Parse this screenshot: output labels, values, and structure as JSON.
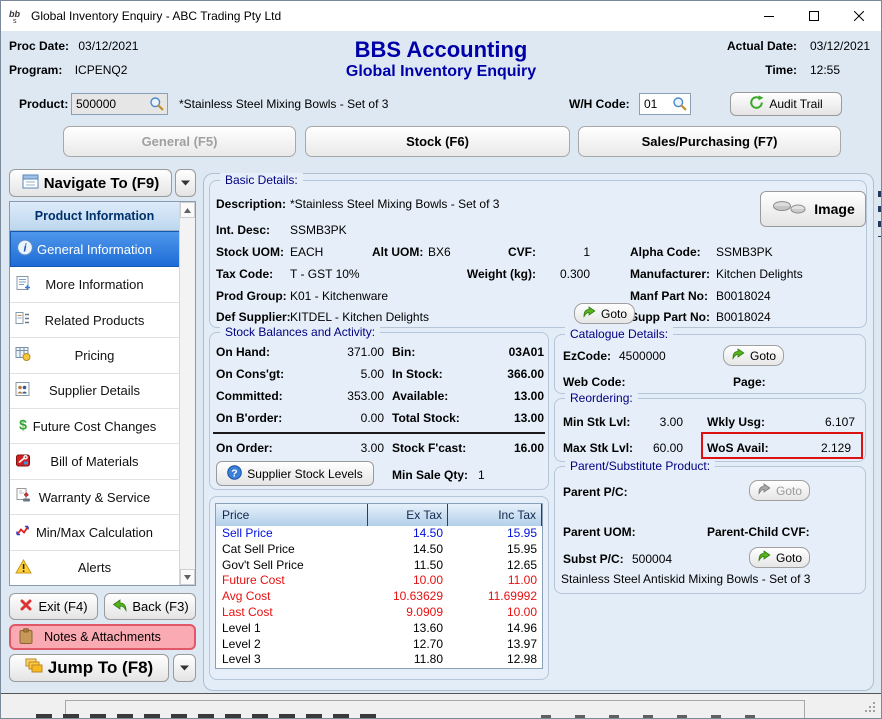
{
  "window": {
    "title": "Global Inventory Enquiry - ABC Trading Pty Ltd"
  },
  "colors": {
    "window_bg": "#dde8f3",
    "titlebar_bg": "#ffffff",
    "navy_title": "#0000a8",
    "selected_item_blue": "#1d6cd6",
    "notes_pink_bg": "#f9aab2",
    "notes_pink_border": "#e05868",
    "goto_green": "#55b41e",
    "price_blue": "#0010dd",
    "price_red": "#e81010",
    "highlight_red": "#dd1111"
  },
  "icons": {
    "app_logo": "bbs-logo",
    "search": "magnifier",
    "goto": "green-curved-arrow",
    "back": "green-undo-arrow",
    "exit": "red-x",
    "audit": "green-recycle",
    "help": "blue-question-circle",
    "alerts": "yellow-warning-triangle",
    "notes": "clipboard",
    "navigate": "form-window",
    "jump": "cascade-folders",
    "image": "mixing-bowls-thumbnail",
    "minimize": "minimize-line",
    "maximize": "maximize-box",
    "close": "close-x"
  },
  "header": {
    "proc_date_label": "Proc Date:",
    "proc_date": "03/12/2021",
    "program_label": "Program:",
    "program": "ICPENQ2",
    "app_title": "BBS Accounting",
    "screen_title": "Global Inventory Enquiry",
    "actual_date_label": "Actual Date:",
    "actual_date": "03/12/2021",
    "time_label": "Time:",
    "time": "12:55"
  },
  "product_bar": {
    "product_label": "Product:",
    "product_code": "500000",
    "product_desc": "*Stainless Steel Mixing Bowls - Set of 3",
    "wh_label": "W/H Code:",
    "wh_code": "01",
    "audit_trail": "Audit Trail"
  },
  "tabs": [
    {
      "label": "General (F5)",
      "disabled": true
    },
    {
      "label": "Stock (F6)"
    },
    {
      "label": "Sales/Purchasing (F7)"
    }
  ],
  "sidebar": {
    "navigate_to": "Navigate To (F9)",
    "group_header": "Product Information",
    "items": [
      {
        "label": "General Information",
        "selected": true
      },
      {
        "label": "More Information"
      },
      {
        "label": "Related Products"
      },
      {
        "label": "Pricing"
      },
      {
        "label": "Supplier Details"
      },
      {
        "label": "Future Cost Changes"
      },
      {
        "label": "Bill of Materials"
      },
      {
        "label": "Warranty & Service"
      },
      {
        "label": "Min/Max Calculation"
      },
      {
        "label": "Alerts"
      }
    ],
    "exit": "Exit (F4)",
    "back": "Back (F3)",
    "notes": "Notes & Attachments",
    "jump_to": "Jump To (F8)"
  },
  "basic": {
    "title": "Basic Details:",
    "description_label": "Description:",
    "description": "*Stainless Steel Mixing Bowls - Set of 3",
    "int_desc_label": "Int. Desc:",
    "int_desc": "SSMB3PK",
    "stock_uom_label": "Stock UOM:",
    "stock_uom": "EACH",
    "alt_uom_label": "Alt UOM:",
    "alt_uom": "BX6",
    "cvf_label": "CVF:",
    "cvf": "1",
    "tax_code_label": "Tax Code:",
    "tax_code": "T - GST 10%",
    "weight_label": "Weight (kg):",
    "weight": "0.300",
    "prod_group_label": "Prod Group:",
    "prod_group": "K01 - Kitchenware",
    "def_supplier_label": "Def Supplier:",
    "def_supplier": "KITDEL - Kitchen Delights",
    "alpha_code_label": "Alpha Code:",
    "alpha_code": "SSMB3PK",
    "manufacturer_label": "Manufacturer:",
    "manufacturer": "Kitchen Delights",
    "manf_part_label": "Manf Part No:",
    "manf_part": "B0018024",
    "supp_part_label": "Supp Part No:",
    "supp_part": "B0018024",
    "goto_label": "Goto",
    "image_label": "Image"
  },
  "stock": {
    "title": "Stock Balances and Activity:",
    "left": [
      {
        "label": "On Hand:",
        "value": "371.00"
      },
      {
        "label": "On Cons'gt:",
        "value": "5.00"
      },
      {
        "label": "Committed:",
        "value": "353.00"
      },
      {
        "label": "On B'order:",
        "value": "0.00"
      },
      {
        "label": "On Order:",
        "value": "3.00"
      }
    ],
    "right": [
      {
        "label": "Bin:",
        "value": "03A01"
      },
      {
        "label": "In Stock:",
        "value": "366.00"
      },
      {
        "label": "Available:",
        "value": "13.00"
      },
      {
        "label": "Total Stock:",
        "value": "13.00"
      },
      {
        "label": "Stock F'cast:",
        "value": "16.00"
      }
    ],
    "supplier_stock_levels": "Supplier Stock Levels",
    "min_sale_qty_label": "Min Sale Qty:",
    "min_sale_qty": "1"
  },
  "catalogue": {
    "title": "Catalogue Details:",
    "ezcode_label": "EzCode:",
    "ezcode": "4500000",
    "goto_label": "Goto",
    "web_code_label": "Web Code:",
    "page_label": "Page:"
  },
  "reordering": {
    "title": "Reordering:",
    "min_stk_label": "Min Stk Lvl:",
    "min_stk": "3.00",
    "wkly_usg_label": "Wkly Usg:",
    "wkly_usg": "6.107",
    "max_stk_label": "Max Stk Lvl:",
    "max_stk": "60.00",
    "wos_label": "WoS Avail:",
    "wos": "2.129"
  },
  "parent_sub": {
    "title": "Parent/Substitute Product:",
    "parent_pc_label": "Parent P/C:",
    "goto_disabled_label": "Goto",
    "parent_uom_label": "Parent UOM:",
    "parent_child_cvf_label": "Parent-Child CVF:",
    "subst_pc_label": "Subst P/C:",
    "subst_pc": "500004",
    "goto_label": "Goto",
    "subst_desc": "Stainless Steel Antiskid Mixing Bowls - Set of 3"
  },
  "price": {
    "headers": [
      "Price",
      "Ex Tax",
      "Inc Tax"
    ],
    "rows": [
      {
        "label": "Sell Price",
        "ex": "14.50",
        "inc": "15.95",
        "color": "blue"
      },
      {
        "label": "Cat Sell Price",
        "ex": "14.50",
        "inc": "15.95",
        "color": "black"
      },
      {
        "label": "Gov't Sell Price",
        "ex": "11.50",
        "inc": "12.65",
        "color": "black"
      },
      {
        "label": "Future Cost",
        "ex": "10.00",
        "inc": "11.00",
        "color": "red"
      },
      {
        "label": "Avg Cost",
        "ex": "10.63629",
        "inc": "11.69992",
        "color": "red"
      },
      {
        "label": "Last Cost",
        "ex": "9.0909",
        "inc": "10.00",
        "color": "red"
      },
      {
        "label": "Level 1",
        "ex": "13.60",
        "inc": "14.96",
        "color": "black"
      },
      {
        "label": "Level 2",
        "ex": "12.70",
        "inc": "13.97",
        "color": "black"
      },
      {
        "label": "Level 3",
        "ex": "11.80",
        "inc": "12.98",
        "color": "black"
      }
    ]
  }
}
